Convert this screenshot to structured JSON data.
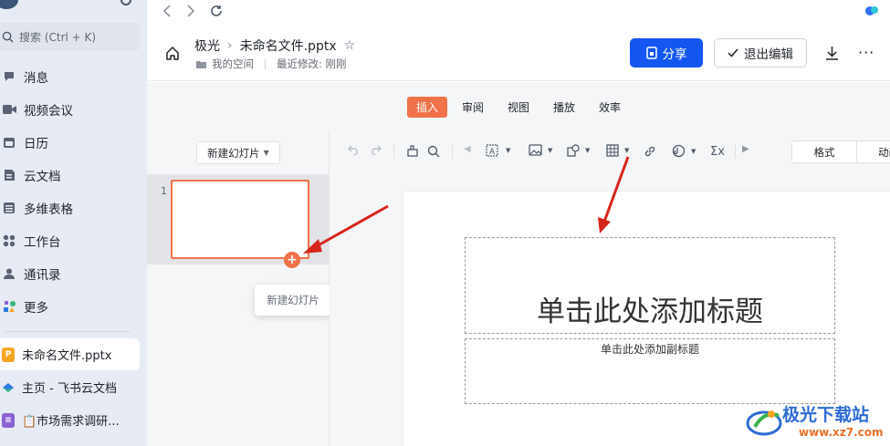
{
  "sidebar": {
    "search_placeholder": "搜索 (Ctrl + K)",
    "nav": [
      {
        "label": "消息",
        "icon": "message-icon"
      },
      {
        "label": "视频会议",
        "icon": "video-icon"
      },
      {
        "label": "日历",
        "icon": "calendar-icon"
      },
      {
        "label": "云文档",
        "icon": "cloud-doc-icon"
      },
      {
        "label": "多维表格",
        "icon": "table-icon"
      },
      {
        "label": "工作台",
        "icon": "workplace-icon"
      },
      {
        "label": "通讯录",
        "icon": "contacts-icon"
      },
      {
        "label": "更多",
        "icon": "more-apps-icon"
      }
    ],
    "recent": [
      {
        "label": "未命名文件.pptx",
        "active": true,
        "color": "#f5a623",
        "badge": "P"
      },
      {
        "label": "主页 - 飞书云文档",
        "active": false,
        "color": "#2c7be5"
      },
      {
        "label": "📋市场需求调研...",
        "active": false,
        "color": "#8a63d2"
      }
    ]
  },
  "header": {
    "breadcrumb_root": "极光",
    "filename": "未命名文件.pptx",
    "location": "我的空间",
    "last_modified": "最近修改: 刚刚",
    "share_label": "分享",
    "exit_edit_label": "退出编辑"
  },
  "tabs": [
    "插入",
    "审阅",
    "视图",
    "播放",
    "效率"
  ],
  "active_tab": "插入",
  "thumbs": {
    "new_slide_label": "新建幻灯片",
    "slide_number": "1",
    "tooltip": "新建幻灯片"
  },
  "toolbar": {
    "format_label": "格式",
    "animation_label": "动画"
  },
  "slide": {
    "title_placeholder": "单击此处添加标题",
    "subtitle_placeholder": "单击此处添加副标题"
  },
  "watermark": {
    "name": "极光下载站",
    "url": "www.xz7.com"
  },
  "colors": {
    "accent": "#f0724a",
    "primary": "#1456f0",
    "arrow": "#d8251c"
  }
}
